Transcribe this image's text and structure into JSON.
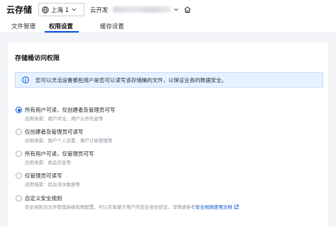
{
  "header": {
    "app_title": "云存储",
    "region": "上海 1",
    "env_label": "云开发"
  },
  "tabs": [
    {
      "label": "文件管理"
    },
    {
      "label": "权限设置"
    },
    {
      "label": "缓存设置"
    }
  ],
  "panel": {
    "title": "存储桶访问权限",
    "notice": "您可以灵活设置哪些用户是否可以读写该存储桶的文件，以保证业务的数据安全。",
    "options": [
      {
        "label": "所有用户可读，仅创建者及管理员可写",
        "desc": "适用场景：用户评论、用户公开信息等",
        "checked": true
      },
      {
        "label": "仅创建者及管理员可读写",
        "desc": "适用场景：用户个人设置、用户订单管理等",
        "checked": false
      },
      {
        "label": "所有用户可读，仅管理员可写",
        "desc": "适用场景：商品信息等",
        "checked": false
      },
      {
        "label": "仅管理员可读写",
        "desc": "适用场景：后台流水数据等",
        "checked": false
      },
      {
        "label": "自定义安全规则",
        "desc": "安全规则为文件管理高级权限配置，可以实现基于用户的安全身份验证，详情请参考",
        "link": "安全规则使用文档",
        "checked": false
      }
    ]
  },
  "colors": {
    "accent": "#0052d9",
    "notice_bg": "#e8f1ff"
  }
}
